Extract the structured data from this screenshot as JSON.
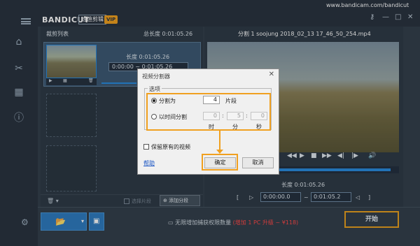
{
  "window": {
    "url": "www.bandicam.com/bandicut"
  },
  "logo": {
    "name": "BANDICUT",
    "badge": "班迪剪辑",
    "vip": "VIP"
  },
  "left_panel": {
    "title": "裁剪列表",
    "total_length": "总长度 0:01:05.26",
    "clip_length": "长度 0:01:05.26",
    "clip_time": "0:00:00 ~ 0:01:05.26",
    "select_label": "选择片段",
    "add_segment": "添加分段"
  },
  "right_panel": {
    "title": "分割 1   soojung 2018_02_13 17_46_50_254.mp4",
    "length": "长度 0:01:05.26",
    "time_start": "0:00:00.0",
    "time_end": "0:01:05.2"
  },
  "dialog": {
    "title": "视频分割器",
    "options_legend": "选项",
    "split_count_label": "分割为",
    "split_count_value": "4",
    "split_count_unit": "片段",
    "split_time_label": "以时间分割",
    "hours": "0",
    "minutes": "5",
    "seconds": "0",
    "hours_label": "时",
    "minutes_label": "分",
    "seconds_label": "秒",
    "keep_original_label": "保留原有的视频",
    "help_link": "帮助",
    "ok_label": "确定",
    "cancel_label": "取消"
  },
  "bottom": {
    "promo_text": "无限增加捕获权限数量",
    "promo_highlight": "(增加 1 PC 升级 ~ ¥118)",
    "start_label": "开始"
  },
  "colors": {
    "accent": "#2a8cde",
    "highlight": "#f0a020"
  }
}
